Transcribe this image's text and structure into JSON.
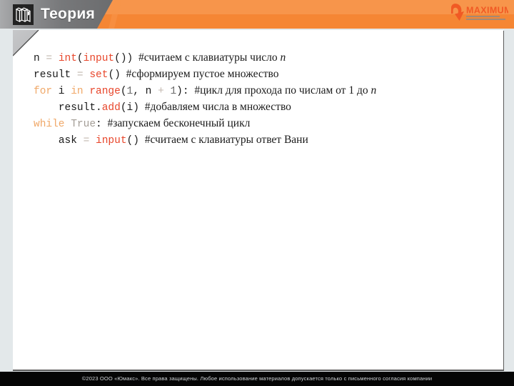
{
  "header": {
    "title": "Теория",
    "icon": "books-icon",
    "grey_color": "#7a7b7d",
    "orange_color": "#f58634",
    "logo": {
      "name": "MAXIMUM",
      "tagline_line1": "ОБРАЗОВАНИЕ",
      "tagline_line2": "ДЛЯ ЛУЧШЕГО БУДУЩЕГО"
    }
  },
  "code": {
    "language": "python",
    "lines": [
      {
        "indent": 0,
        "tokens": [
          {
            "t": "n",
            "c": "plain"
          },
          {
            "t": " ",
            "c": "plain"
          },
          {
            "t": "=",
            "c": "op"
          },
          {
            "t": " ",
            "c": "plain"
          },
          {
            "t": "int",
            "c": "builtin"
          },
          {
            "t": "(",
            "c": "plain"
          },
          {
            "t": "input",
            "c": "builtin"
          },
          {
            "t": "())",
            "c": "plain"
          }
        ],
        "comment": "#считаем с клавиатуры число ",
        "comment_italic": "n"
      },
      {
        "indent": 0,
        "tokens": [
          {
            "t": "result",
            "c": "plain"
          },
          {
            "t": " ",
            "c": "plain"
          },
          {
            "t": "=",
            "c": "op"
          },
          {
            "t": " ",
            "c": "plain"
          },
          {
            "t": "set",
            "c": "builtin"
          },
          {
            "t": "()",
            "c": "plain"
          }
        ],
        "comment": "#сформируем пустое множество",
        "comment_italic": ""
      },
      {
        "indent": 0,
        "tokens": [
          {
            "t": "for",
            "c": "kw"
          },
          {
            "t": " i ",
            "c": "plain"
          },
          {
            "t": "in",
            "c": "kw"
          },
          {
            "t": " ",
            "c": "plain"
          },
          {
            "t": "range",
            "c": "builtin"
          },
          {
            "t": "(",
            "c": "plain"
          },
          {
            "t": "1",
            "c": "num"
          },
          {
            "t": ", n ",
            "c": "plain"
          },
          {
            "t": "+",
            "c": "op"
          },
          {
            "t": " ",
            "c": "plain"
          },
          {
            "t": "1",
            "c": "num"
          },
          {
            "t": "):",
            "c": "plain"
          }
        ],
        "comment": "#цикл для прохода по числам от 1 до ",
        "comment_italic": "n"
      },
      {
        "indent": 1,
        "tokens": [
          {
            "t": "result.",
            "c": "plain"
          },
          {
            "t": "add",
            "c": "builtin"
          },
          {
            "t": "(i)",
            "c": "plain"
          }
        ],
        "comment": "#добавляем числа в множество",
        "comment_italic": ""
      },
      {
        "indent": 0,
        "tokens": [
          {
            "t": "while",
            "c": "kw"
          },
          {
            "t": " ",
            "c": "plain"
          },
          {
            "t": "True",
            "c": "const"
          },
          {
            "t": ":",
            "c": "plain"
          }
        ],
        "comment": "#запускаем бесконечный цикл",
        "comment_italic": ""
      },
      {
        "indent": 1,
        "tokens": [
          {
            "t": "ask",
            "c": "plain"
          },
          {
            "t": " ",
            "c": "plain"
          },
          {
            "t": "=",
            "c": "op"
          },
          {
            "t": " ",
            "c": "plain"
          },
          {
            "t": "input",
            "c": "builtin"
          },
          {
            "t": "()",
            "c": "plain"
          }
        ],
        "comment": "#считаем с клавиатуры ответ Вани",
        "comment_italic": ""
      }
    ]
  },
  "footer": {
    "copyright": "©2023 ООО «Юмакс». Все права защищены. Любое использование материалов допускается только с  письменного согласия компании"
  }
}
